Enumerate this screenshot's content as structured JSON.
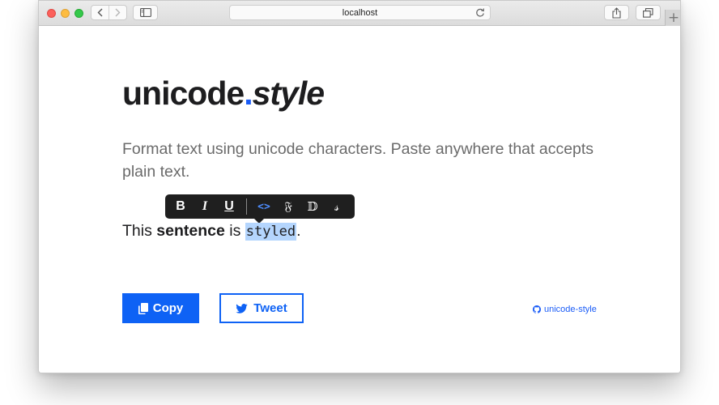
{
  "browser": {
    "address": "localhost",
    "new_tab_label": "+"
  },
  "hero": {
    "title_main": "unicode",
    "title_dot": ".",
    "title_italic": "style",
    "subtitle": "Format text using unicode characters. Paste anywhere that accepts plain text."
  },
  "format_toolbar": {
    "bold": "B",
    "italic": "I",
    "underline": "U",
    "code": "<>",
    "fraktur": "𝔉",
    "double_struck": "𝔻",
    "script": "𝓈"
  },
  "sample": {
    "part1": "This ",
    "bold_word": "sentence",
    "part2": " is ",
    "mono_word": "styled",
    "part3": "."
  },
  "actions": {
    "copy_label": "Copy",
    "tweet_label": "Tweet",
    "github_label": "unicode-style"
  },
  "colors": {
    "accent": "#0e62f5",
    "selection": "#b4d5fd",
    "toolbar_bg": "#1f1f1f"
  }
}
